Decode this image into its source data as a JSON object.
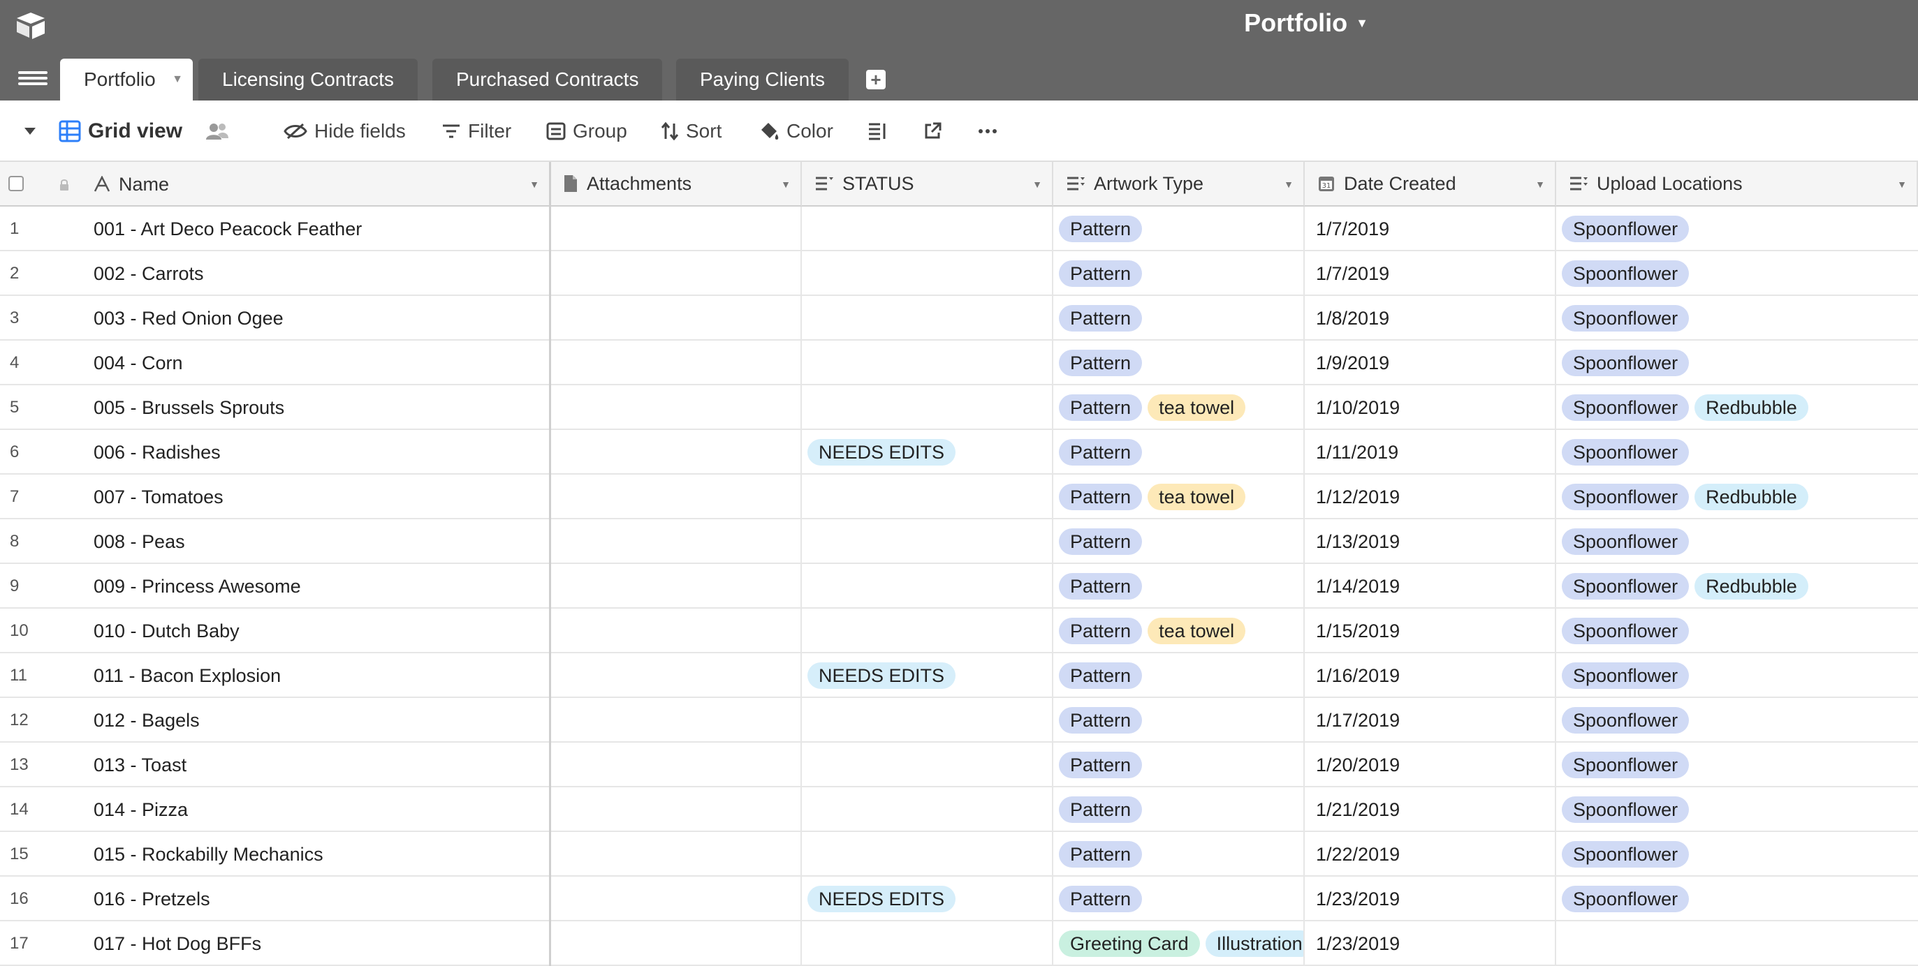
{
  "app": {
    "base_title": "Portfolio",
    "logo_icon": "airtable-logo-icon"
  },
  "tabs": [
    {
      "label": "Portfolio",
      "active": true
    },
    {
      "label": "Licensing Contracts",
      "active": false
    },
    {
      "label": "Purchased Contracts",
      "active": false
    },
    {
      "label": "Paying Clients",
      "active": false
    }
  ],
  "toolbar": {
    "view_name": "Grid view",
    "hide_fields": "Hide fields",
    "filter": "Filter",
    "group": "Group",
    "sort": "Sort",
    "color": "Color"
  },
  "columns": [
    "Name",
    "Attachments",
    "STATUS",
    "Artwork Type",
    "Date Created",
    "Upload Locations"
  ],
  "chip_colors": {
    "Pattern": "#d0daf5",
    "tea towel": "#fde9b8",
    "NEEDS EDITS": "#d6eefa",
    "Spoonflower": "#d0daf5",
    "Redbubble": "#d4eefa",
    "Greeting Card": "#c9f0e0",
    "Illustration": "#d4eefa"
  },
  "rows": [
    {
      "num": "1",
      "name": "001 - Art Deco Peacock Feather",
      "status": "",
      "artwork": [
        "Pattern"
      ],
      "date": "1/7/2019",
      "uploads": [
        "Spoonflower"
      ]
    },
    {
      "num": "2",
      "name": "002 - Carrots",
      "status": "",
      "artwork": [
        "Pattern"
      ],
      "date": "1/7/2019",
      "uploads": [
        "Spoonflower"
      ]
    },
    {
      "num": "3",
      "name": "003 - Red Onion Ogee",
      "status": "",
      "artwork": [
        "Pattern"
      ],
      "date": "1/8/2019",
      "uploads": [
        "Spoonflower"
      ]
    },
    {
      "num": "4",
      "name": "004 - Corn",
      "status": "",
      "artwork": [
        "Pattern"
      ],
      "date": "1/9/2019",
      "uploads": [
        "Spoonflower"
      ]
    },
    {
      "num": "5",
      "name": "005 - Brussels Sprouts",
      "status": "",
      "artwork": [
        "Pattern",
        "tea towel"
      ],
      "date": "1/10/2019",
      "uploads": [
        "Spoonflower",
        "Redbubble"
      ]
    },
    {
      "num": "6",
      "name": "006 - Radishes",
      "status": "NEEDS EDITS",
      "artwork": [
        "Pattern"
      ],
      "date": "1/11/2019",
      "uploads": [
        "Spoonflower"
      ]
    },
    {
      "num": "7",
      "name": "007 - Tomatoes",
      "status": "",
      "artwork": [
        "Pattern",
        "tea towel"
      ],
      "date": "1/12/2019",
      "uploads": [
        "Spoonflower",
        "Redbubble"
      ]
    },
    {
      "num": "8",
      "name": "008 - Peas",
      "status": "",
      "artwork": [
        "Pattern"
      ],
      "date": "1/13/2019",
      "uploads": [
        "Spoonflower"
      ]
    },
    {
      "num": "9",
      "name": "009 - Princess Awesome",
      "status": "",
      "artwork": [
        "Pattern"
      ],
      "date": "1/14/2019",
      "uploads": [
        "Spoonflower",
        "Redbubble"
      ]
    },
    {
      "num": "10",
      "name": "010 - Dutch Baby",
      "status": "",
      "artwork": [
        "Pattern",
        "tea towel"
      ],
      "date": "1/15/2019",
      "uploads": [
        "Spoonflower"
      ]
    },
    {
      "num": "11",
      "name": "011 - Bacon Explosion",
      "status": "NEEDS EDITS",
      "artwork": [
        "Pattern"
      ],
      "date": "1/16/2019",
      "uploads": [
        "Spoonflower"
      ]
    },
    {
      "num": "12",
      "name": "012 - Bagels",
      "status": "",
      "artwork": [
        "Pattern"
      ],
      "date": "1/17/2019",
      "uploads": [
        "Spoonflower"
      ]
    },
    {
      "num": "13",
      "name": "013 - Toast",
      "status": "",
      "artwork": [
        "Pattern"
      ],
      "date": "1/20/2019",
      "uploads": [
        "Spoonflower"
      ]
    },
    {
      "num": "14",
      "name": "014 - Pizza",
      "status": "",
      "artwork": [
        "Pattern"
      ],
      "date": "1/21/2019",
      "uploads": [
        "Spoonflower"
      ]
    },
    {
      "num": "15",
      "name": "015 - Rockabilly Mechanics",
      "status": "",
      "artwork": [
        "Pattern"
      ],
      "date": "1/22/2019",
      "uploads": [
        "Spoonflower"
      ]
    },
    {
      "num": "16",
      "name": "016 - Pretzels",
      "status": "NEEDS EDITS",
      "artwork": [
        "Pattern"
      ],
      "date": "1/23/2019",
      "uploads": [
        "Spoonflower"
      ]
    },
    {
      "num": "17",
      "name": "017 - Hot Dog BFFs",
      "status": "",
      "artwork": [
        "Greeting Card",
        "Illustration"
      ],
      "date": "1/23/2019",
      "uploads": []
    }
  ]
}
